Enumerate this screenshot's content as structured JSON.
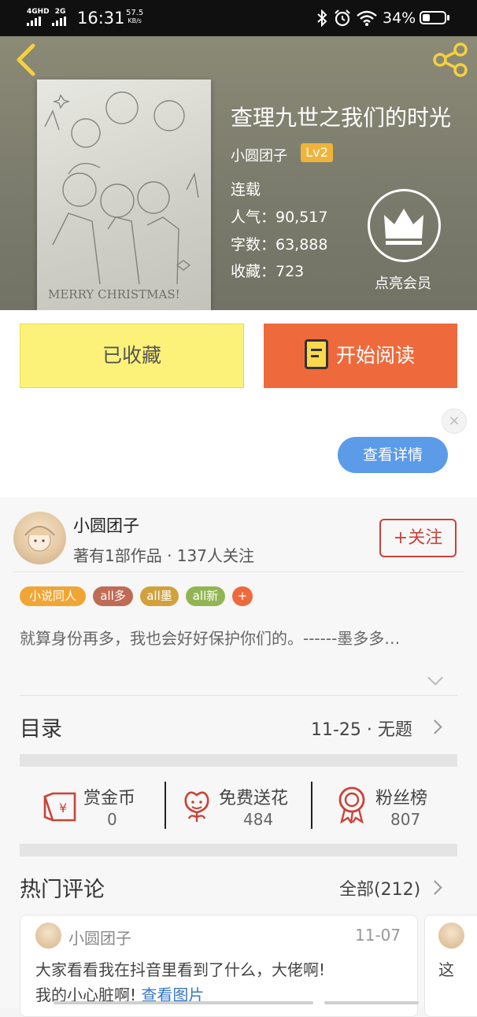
{
  "status_bar": {
    "network_1": "4GHD",
    "network_2": "2G",
    "time": "16:31",
    "speed_value": "57.5",
    "speed_unit": "KB/s",
    "battery_percent": "34%",
    "battery_level": 0.34,
    "icons": [
      "bluetooth-icon",
      "alarm-icon",
      "wifi-icon",
      "battery-icon"
    ]
  },
  "header": {
    "back_icon": "back-chevron-icon",
    "share_icon": "share-icon",
    "title": "查理九世之我们的时光",
    "author": "小圆团子",
    "author_level": "Lv2",
    "status": "连载",
    "popularity": "人气：90,517",
    "word_count": "字数：63,888",
    "favorites": "收藏：723",
    "vip_icon": "crown-icon",
    "vip_label": "点亮会员",
    "cover_text": "MERRY CHRISTMAS!"
  },
  "actions": {
    "collected_label": "已收藏",
    "read_label": "开始阅读",
    "read_icon": "book-icon"
  },
  "ad": {
    "close_glyph": "×",
    "detail_label": "查看详情"
  },
  "author_card": {
    "name": "小圆团子",
    "stats": "著有1部作品 · 137人关注",
    "follow_label": "+关注",
    "tags": [
      {
        "label": "小说同人",
        "color": "#f0a535"
      },
      {
        "label": "all多",
        "color": "#bf6b55"
      },
      {
        "label": "all墨",
        "color": "#d2a13d"
      },
      {
        "label": "all新",
        "color": "#92b554"
      },
      {
        "label": "+",
        "color": "#ee6a3c"
      }
    ],
    "description": "就算身份再多，我也会好好保护你们的。------墨多多…"
  },
  "toc": {
    "title": "目录",
    "latest": "11-25 · 无题"
  },
  "stats": [
    {
      "icon": "red-envelope-icon",
      "label": "赏金币",
      "value": "0"
    },
    {
      "icon": "flower-icon",
      "label": "免费送花",
      "value": "484"
    },
    {
      "icon": "rosette-icon",
      "label": "粉丝榜",
      "value": "807"
    }
  ],
  "comments": {
    "title": "热门评论",
    "all_label": "全部(212)",
    "items": [
      {
        "user": "小圆团子",
        "date": "11-07",
        "text_line1": "大家看看我在抖音里看到了什么，大佬啊!",
        "text_line2": "我的小心脏啊!",
        "link": "查看图片"
      },
      {
        "text_line1": "这"
      }
    ]
  },
  "colors": {
    "accent_orange": "#ee6a3c",
    "collected_yellow": "#fdf279",
    "follow_red": "#c94338",
    "detail_blue": "#5b9be8"
  }
}
